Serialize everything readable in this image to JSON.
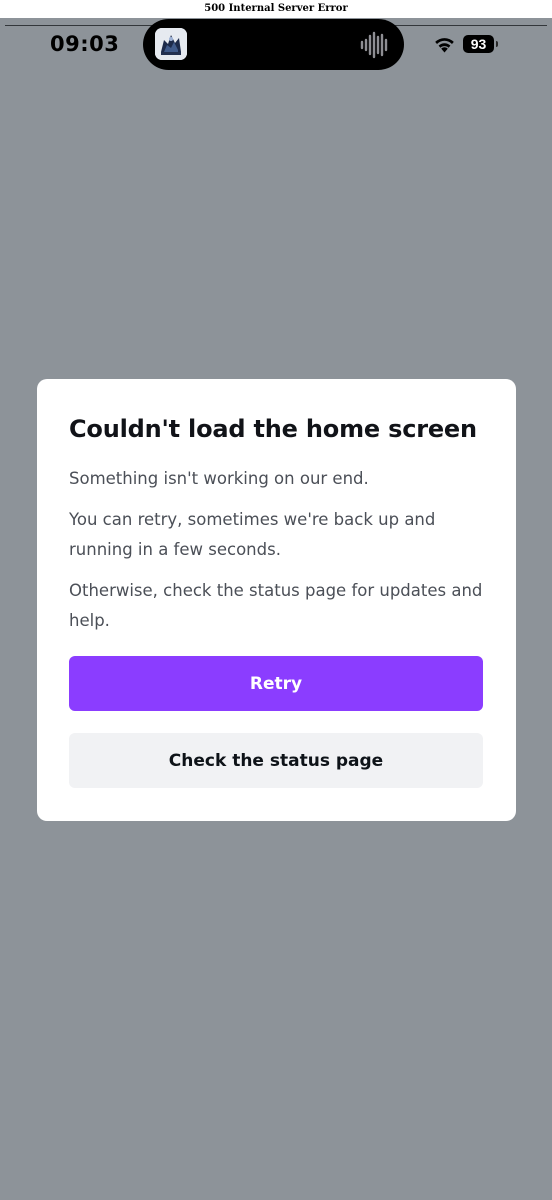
{
  "page": {
    "error_title": "500 Internal Server Error"
  },
  "status_bar": {
    "time": "09:03",
    "battery": "93",
    "icons": [
      "app-icon",
      "audio-waveform-icon",
      "wifi-icon",
      "battery-icon"
    ]
  },
  "dialog": {
    "title": "Couldn't load the home screen",
    "paragraphs": [
      "Something isn't working on our end.",
      "You can retry, sometimes we're back up and running in a few seconds.",
      "Otherwise, check the status page for updates and help."
    ],
    "primary_button": "Retry",
    "secondary_button": "Check the status page"
  },
  "colors": {
    "backdrop": "#8d9399",
    "primary": "#8b3dff",
    "secondary_button_bg": "#f1f2f4",
    "card": "#ffffff"
  }
}
